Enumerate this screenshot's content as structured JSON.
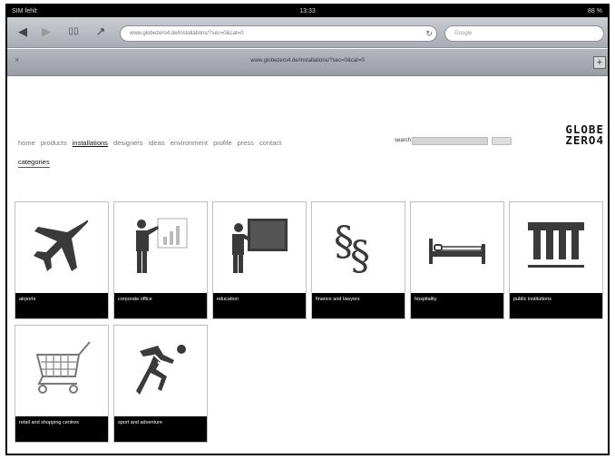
{
  "status": {
    "carrier": "SIM fehlt",
    "time": "13:33",
    "battery": "88 %"
  },
  "toolbar": {
    "back": "◀",
    "forward": "▶",
    "bookmarks": "▯▯",
    "share": "↗",
    "url": "www.globezero4.de/installations/?sec=0&cat=0",
    "search_placeholder": "Google"
  },
  "tab": {
    "title": "www.globezero4.de/installations/?sec=0&cat=0"
  },
  "site": {
    "nav": [
      "home",
      "products",
      "installations",
      "designers",
      "ideas",
      "environment",
      "profile",
      "press",
      "contact"
    ],
    "active_nav": "installations",
    "categories_link": "categories",
    "search_label": "search",
    "logo_line1": "GLOBE",
    "logo_line2": "ZERO4"
  },
  "tiles": [
    {
      "label": "airports",
      "icon": "airplane-icon"
    },
    {
      "label": "corporate office",
      "icon": "presenter-chart-icon"
    },
    {
      "label": "education",
      "icon": "teacher-board-icon"
    },
    {
      "label": "finance and lawyers",
      "icon": "paragraph-icon"
    },
    {
      "label": "hospitality",
      "icon": "bed-icon"
    },
    {
      "label": "public institutions",
      "icon": "building-columns-icon"
    },
    {
      "label": "retail and shopping centres",
      "icon": "shopping-cart-icon"
    },
    {
      "label": "sport and adventure",
      "icon": "runner-icon"
    }
  ]
}
